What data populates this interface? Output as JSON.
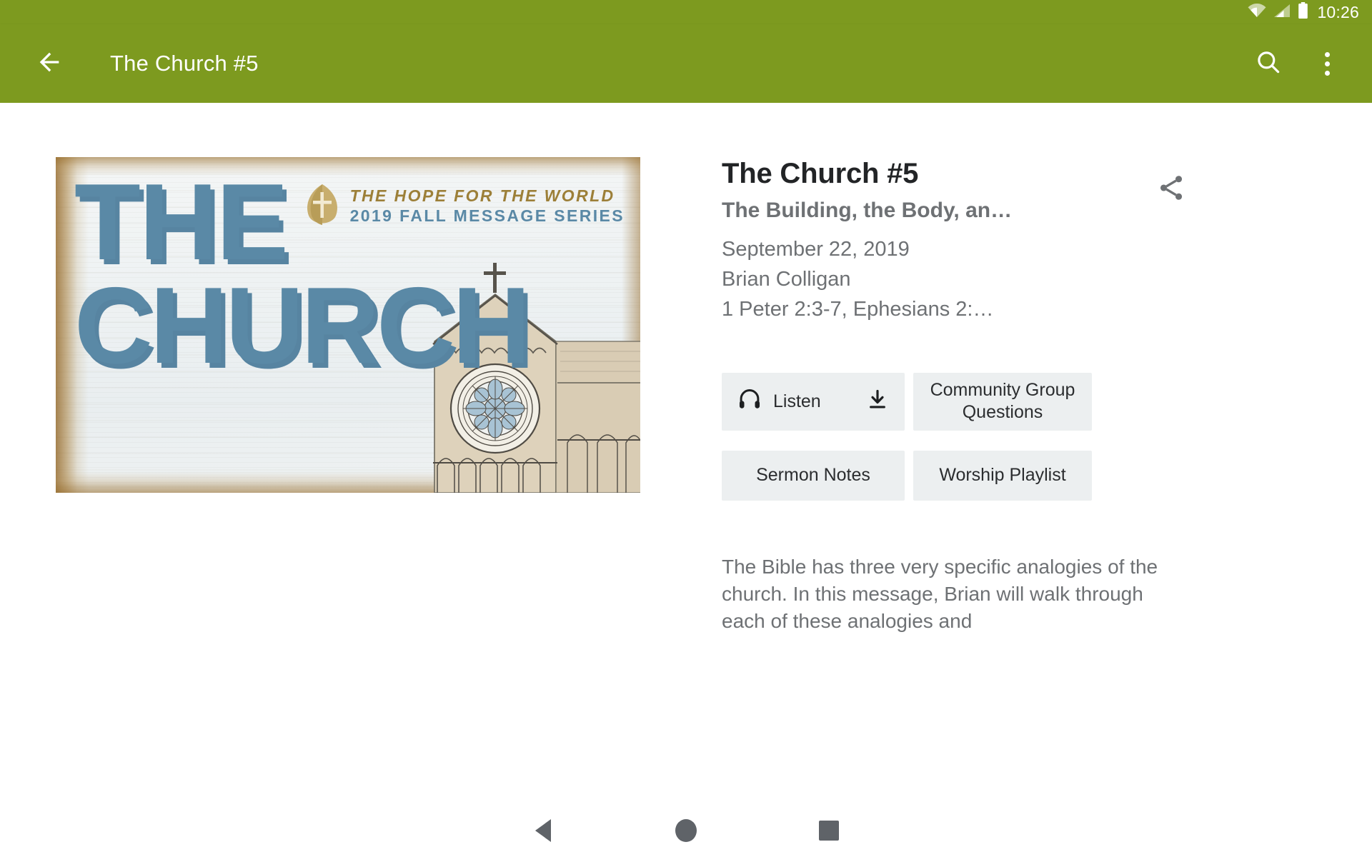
{
  "status_bar": {
    "time": "10:26",
    "icons": [
      "wifi-icon",
      "cell-signal-icon",
      "battery-icon"
    ]
  },
  "app_bar": {
    "back_icon": "arrow-back-icon",
    "title": "The Church #5",
    "search_icon": "search-icon",
    "overflow_icon": "overflow-menu-icon",
    "background_color": "#7d9a1f"
  },
  "artwork": {
    "headline_line1": "THE",
    "headline_line2": "CHURCH",
    "series_line1": "THE HOPE FOR THE WORLD",
    "series_line2": "2019 FALL MESSAGE SERIES",
    "logo_icon": "leaf-cross-logo-icon",
    "building_icon": "church-building-illustration",
    "headline_color": "#5a89a6",
    "series_gold_color": "#9c7f38",
    "series_blue_color": "#5a89a6"
  },
  "detail": {
    "title": "The Church #5",
    "subtitle": "The Building, the Body, an…",
    "date": "September 22, 2019",
    "speaker": "Brian Colligan",
    "scripture": "1 Peter 2:3-7, Ephesians 2:…",
    "share_icon": "share-icon"
  },
  "actions": {
    "listen_label": "Listen",
    "listen_icon": "headphones-icon",
    "download_icon": "download-icon",
    "community_questions_line1": "Community Group",
    "community_questions_line2": "Questions",
    "sermon_notes_label": "Sermon Notes",
    "worship_playlist_label": "Worship Playlist",
    "button_background": "#eceff0"
  },
  "description": {
    "text": "The Bible has three very specific analogies of the church. In this message, Brian will walk through each of these analogies and"
  },
  "nav_bar": {
    "back_icon": "nav-back-icon",
    "home_icon": "nav-home-icon",
    "recents_icon": "nav-recents-icon"
  }
}
